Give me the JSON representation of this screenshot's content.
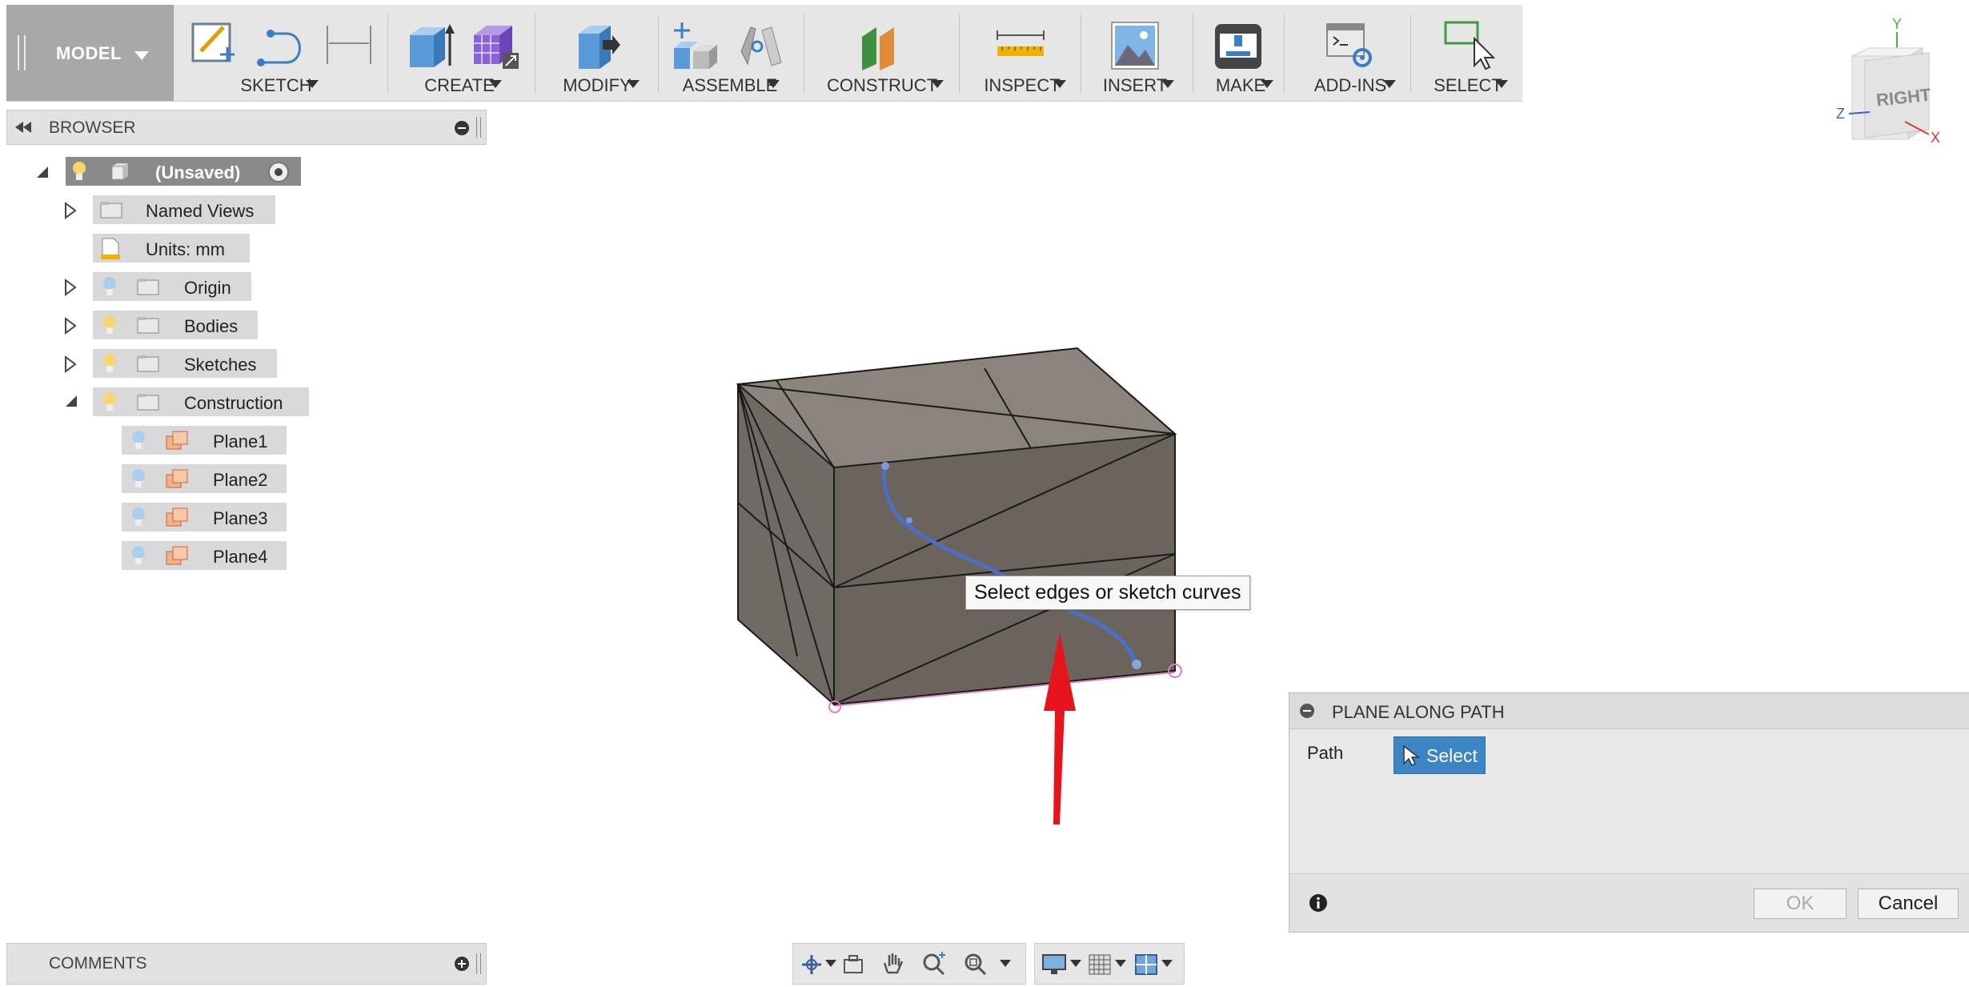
{
  "toolbar": {
    "model_label": "MODEL",
    "groups": {
      "sketch": "SKETCH",
      "create": "CREATE",
      "modify": "MODIFY",
      "assemble": "ASSEMBLE",
      "construct": "CONSTRUCT",
      "inspect": "INSPECT",
      "insert": "INSERT",
      "make": "MAKE",
      "addins": "ADD-INS",
      "select": "SELECT"
    }
  },
  "browser": {
    "title": "BROWSER",
    "root": "(Unsaved)",
    "items": {
      "named_views": "Named Views",
      "units": "Units: mm",
      "origin": "Origin",
      "bodies": "Bodies",
      "sketches": "Sketches",
      "construction": "Construction",
      "plane1": "Plane1",
      "plane2": "Plane2",
      "plane3": "Plane3",
      "plane4": "Plane4"
    }
  },
  "comments": {
    "title": "COMMENTS"
  },
  "viewcube": {
    "face": "RIGHT",
    "axis_y": "Y",
    "axis_z": "Z",
    "axis_x": "X"
  },
  "viewport": {
    "tooltip": "Select edges or sketch curves"
  },
  "dialog": {
    "title": "PLANE ALONG PATH",
    "path_label": "Path",
    "select_label": "Select",
    "ok_label": "OK",
    "cancel_label": "Cancel"
  },
  "colors": {
    "accent": "#3d86c6",
    "arrow": "#e8141c",
    "body": "#6e6760",
    "sketch_curve": "#4a6fc4"
  }
}
